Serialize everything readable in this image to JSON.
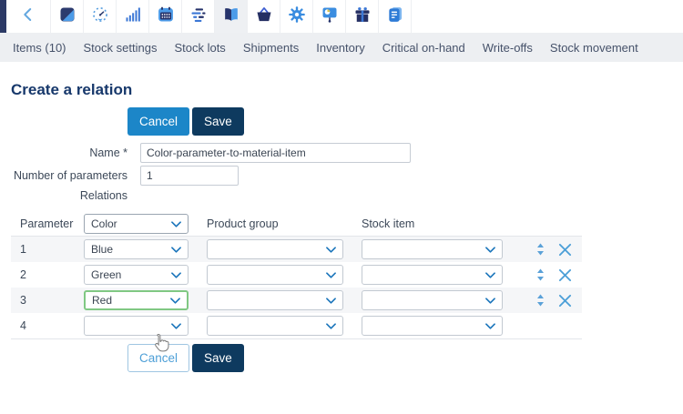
{
  "toolbar": {
    "icons": [
      "back",
      "logo",
      "gauge",
      "bar-chart",
      "calendar",
      "tasks",
      "catalog-book",
      "basket",
      "settings-gear",
      "presentation",
      "gifts",
      "notes"
    ],
    "selected_icon": "catalog-book"
  },
  "nav": {
    "tabs": [
      "Items (10)",
      "Stock settings",
      "Stock lots",
      "Shipments",
      "Inventory",
      "Critical on-hand",
      "Write-offs",
      "Stock movement"
    ]
  },
  "page": {
    "title": "Create a relation"
  },
  "actions": {
    "cancel": "Cancel",
    "save": "Save"
  },
  "form": {
    "name_label": "Name *",
    "name_value": "Color-parameter-to-material-item",
    "num_params_label": "Number of parameters",
    "num_params_value": "1",
    "relations_label": "Relations"
  },
  "table": {
    "header": {
      "parameter_label": "Parameter",
      "parameter_value": "Color",
      "product_group_label": "Product group",
      "stock_item_label": "Stock item"
    },
    "rows": [
      {
        "num": "1",
        "parameter": "Blue",
        "product_group": "",
        "stock_item": ""
      },
      {
        "num": "2",
        "parameter": "Green",
        "product_group": "",
        "stock_item": ""
      },
      {
        "num": "3",
        "parameter": "Red",
        "product_group": "",
        "stock_item": ""
      },
      {
        "num": "4",
        "parameter": "",
        "product_group": "",
        "stock_item": ""
      }
    ]
  },
  "colors": {
    "accent_blue": "#1c86c8",
    "navy": "#0e3a5f",
    "title_blue": "#17386b",
    "icon_blue": "#3b82dc",
    "icon_light_blue": "#4c9be8",
    "icon_navy": "#26336b",
    "row_stripe": "#f5f6f8",
    "focus_green": "#80c883"
  }
}
